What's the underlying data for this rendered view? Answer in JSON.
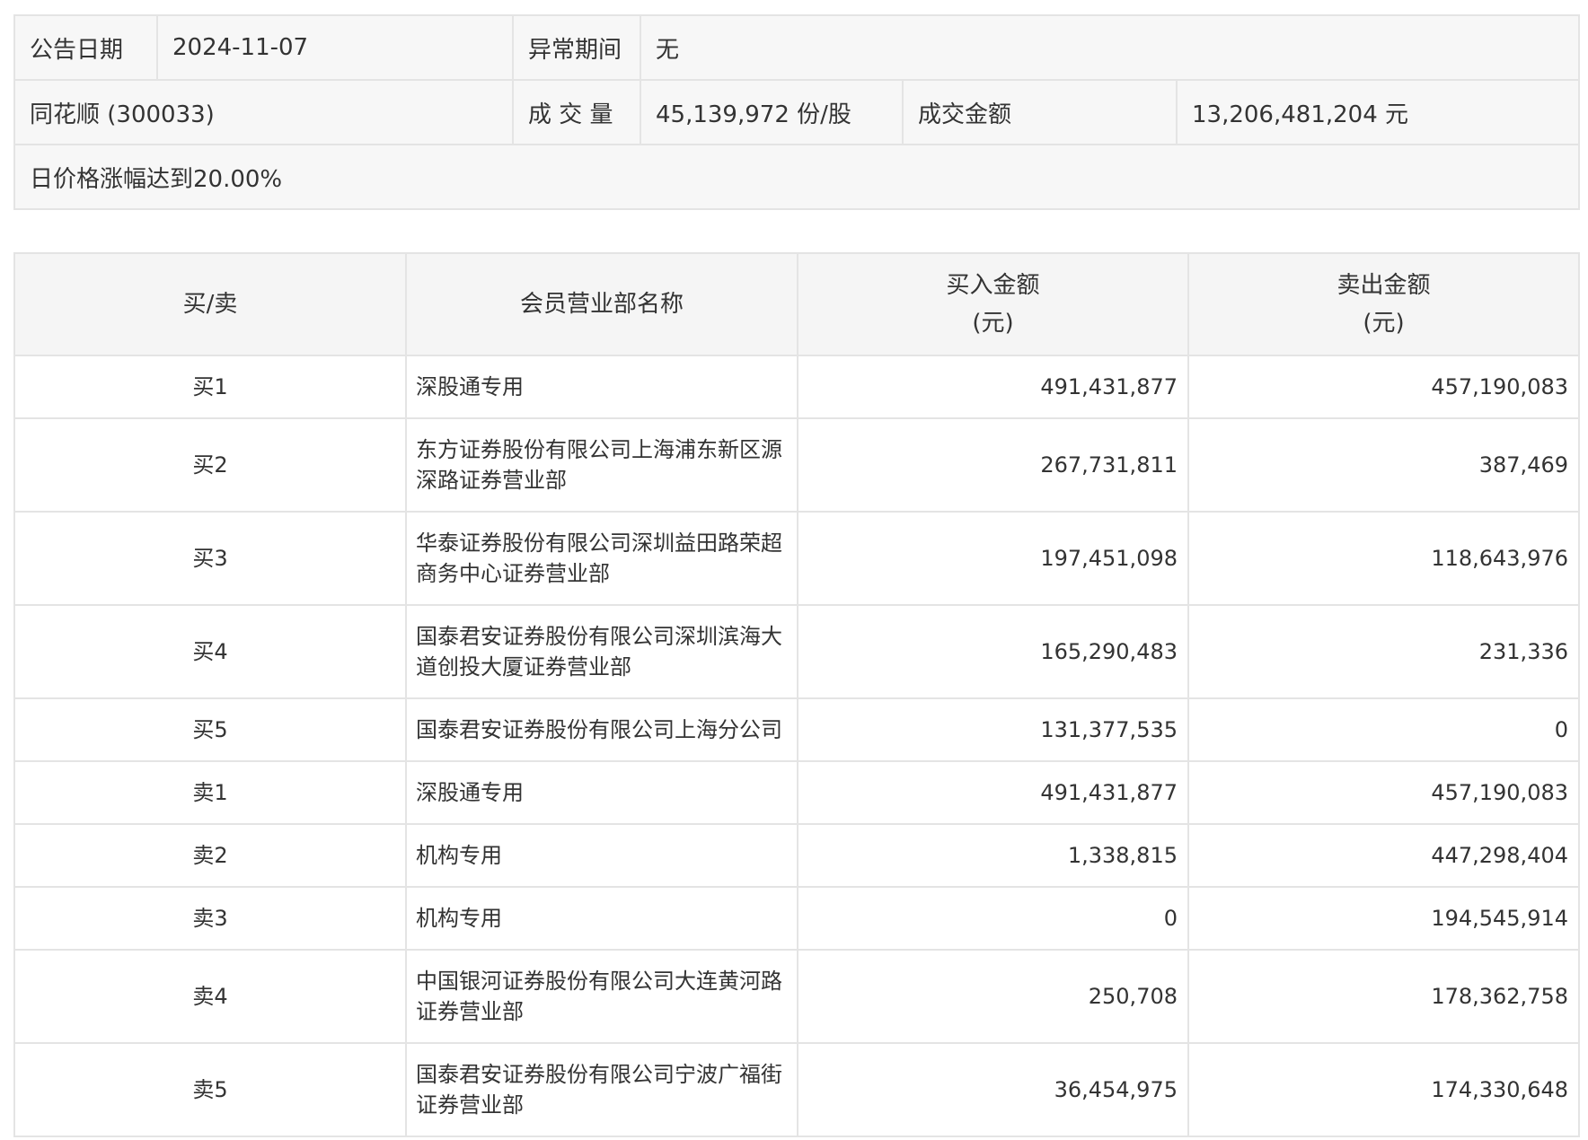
{
  "info": {
    "announce_date_label": "公告日期",
    "announce_date": "2024-11-07",
    "abnormal_period_label": "异常期间",
    "abnormal_period": "无",
    "stock": "同花顺 (300033)",
    "volume_label": "成 交 量",
    "volume": "45,139,972 份/股",
    "turnover_label": "成交金额",
    "turnover": "13,206,481,204 元",
    "reason": "日价格涨幅达到20.00%"
  },
  "table": {
    "headers": {
      "side": "买/卖",
      "member": "会员营业部名称",
      "buy_amount": "买入金额",
      "buy_unit": "(元)",
      "sell_amount": "卖出金额",
      "sell_unit": "(元)"
    },
    "rows": [
      {
        "side": "买1",
        "name": "深股通专用",
        "buy": "491,431,877",
        "sell": "457,190,083"
      },
      {
        "side": "买2",
        "name": "东方证券股份有限公司上海浦东新区源深路证券营业部",
        "buy": "267,731,811",
        "sell": "387,469"
      },
      {
        "side": "买3",
        "name": "华泰证券股份有限公司深圳益田路荣超商务中心证券营业部",
        "buy": "197,451,098",
        "sell": "118,643,976"
      },
      {
        "side": "买4",
        "name": "国泰君安证券股份有限公司深圳滨海大道创投大厦证券营业部",
        "buy": "165,290,483",
        "sell": "231,336"
      },
      {
        "side": "买5",
        "name": "国泰君安证券股份有限公司上海分公司",
        "buy": "131,377,535",
        "sell": "0"
      },
      {
        "side": "卖1",
        "name": "深股通专用",
        "buy": "491,431,877",
        "sell": "457,190,083"
      },
      {
        "side": "卖2",
        "name": "机构专用",
        "buy": "1,338,815",
        "sell": "447,298,404"
      },
      {
        "side": "卖3",
        "name": "机构专用",
        "buy": "0",
        "sell": "194,545,914"
      },
      {
        "side": "卖4",
        "name": "中国银河证券股份有限公司大连黄河路证券营业部",
        "buy": "250,708",
        "sell": "178,362,758"
      },
      {
        "side": "卖5",
        "name": "国泰君安证券股份有限公司宁波广福街证券营业部",
        "buy": "36,454,975",
        "sell": "174,330,648"
      }
    ]
  }
}
